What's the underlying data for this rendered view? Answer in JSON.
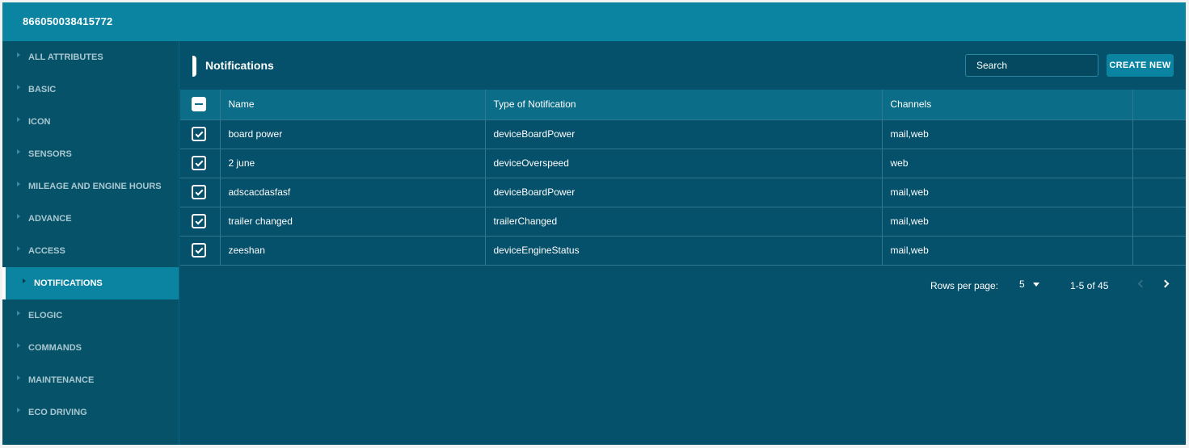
{
  "window": {
    "title": "866050038415772"
  },
  "sidebar": {
    "items": [
      {
        "label": "ALL ATTRIBUTES"
      },
      {
        "label": "BASIC"
      },
      {
        "label": "ICON"
      },
      {
        "label": "SENSORS"
      },
      {
        "label": "MILEAGE AND ENGINE HOURS"
      },
      {
        "label": "ADVANCE"
      },
      {
        "label": "ACCESS"
      },
      {
        "label": "NOTIFICATIONS",
        "active": true
      },
      {
        "label": "ELOGIC"
      },
      {
        "label": "COMMANDS"
      },
      {
        "label": "MAINTENANCE"
      },
      {
        "label": "ECO DRIVING"
      }
    ]
  },
  "main": {
    "title": "Notifications",
    "search": {
      "placeholder": "Search",
      "value": ""
    },
    "create_label": "CREATE NEW"
  },
  "table": {
    "columns": {
      "name": "Name",
      "type": "Type of Notification",
      "channels": "Channels"
    },
    "rows": [
      {
        "checked": true,
        "name": "board power",
        "type": "deviceBoardPower",
        "channels": "mail,web"
      },
      {
        "checked": true,
        "name": "2 june",
        "type": "deviceOverspeed",
        "channels": "web"
      },
      {
        "checked": true,
        "name": "adscacdasfasf",
        "type": "deviceBoardPower",
        "channels": "mail,web"
      },
      {
        "checked": true,
        "name": "trailer changed",
        "type": "trailerChanged",
        "channels": "mail,web"
      },
      {
        "checked": true,
        "name": "zeeshan",
        "type": "deviceEngineStatus",
        "channels": "mail,web"
      }
    ]
  },
  "pagination": {
    "rows_label": "Rows per page:",
    "rows_value": "5",
    "range": "1-5 of 45"
  },
  "colors": {
    "title_bar": "#0b84a1",
    "background": "#05506a",
    "header_row": "#0b6d87"
  }
}
